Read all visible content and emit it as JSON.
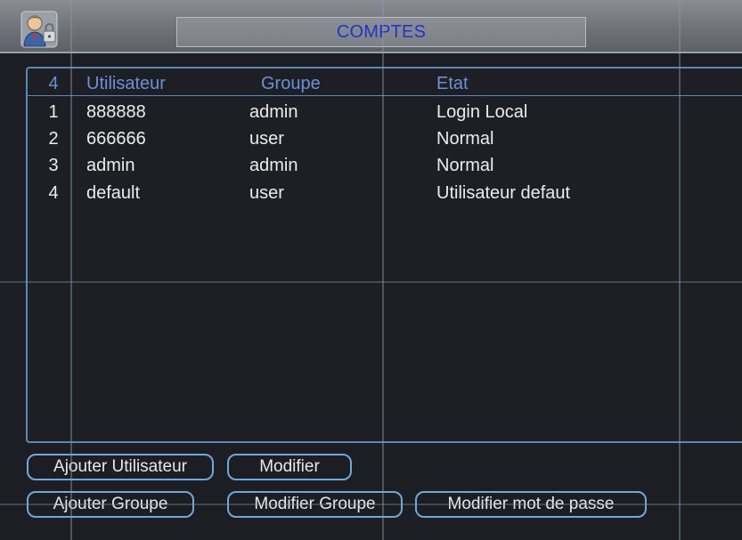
{
  "window": {
    "title": "COMPTES",
    "icon": "user-lock-icon"
  },
  "table": {
    "count_header": "4",
    "columns": [
      "Utilisateur",
      "Groupe",
      "Etat"
    ],
    "rows": [
      {
        "num": "1",
        "user": "888888",
        "group": "admin",
        "state": "Login Local"
      },
      {
        "num": "2",
        "user": "666666",
        "group": "user",
        "state": "Normal"
      },
      {
        "num": "3",
        "user": "admin",
        "group": "admin",
        "state": "Normal"
      },
      {
        "num": "4",
        "user": "default",
        "group": "user",
        "state": "Utilisateur defaut"
      }
    ]
  },
  "buttons": {
    "add_user": "Ajouter Utilisateur",
    "modify": "Modifier",
    "add_group": "Ajouter Groupe",
    "modify_group": "Modifier Groupe",
    "change_password": "Modifier mot de passe"
  },
  "colors": {
    "title_text": "#1f33c9",
    "header_text": "#6e8fd8",
    "accent_border": "#5a88b5"
  }
}
